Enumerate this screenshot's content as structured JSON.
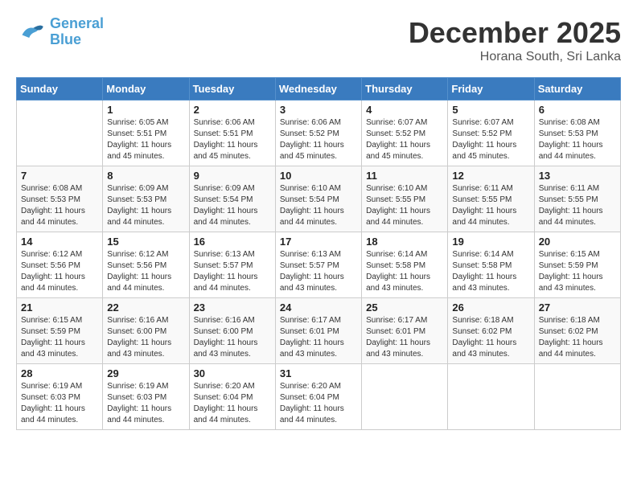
{
  "header": {
    "logo_line1": "General",
    "logo_line2": "Blue",
    "month": "December 2025",
    "location": "Horana South, Sri Lanka"
  },
  "days_of_week": [
    "Sunday",
    "Monday",
    "Tuesday",
    "Wednesday",
    "Thursday",
    "Friday",
    "Saturday"
  ],
  "weeks": [
    [
      {
        "day": "",
        "info": ""
      },
      {
        "day": "1",
        "info": "Sunrise: 6:05 AM\nSunset: 5:51 PM\nDaylight: 11 hours and 45 minutes."
      },
      {
        "day": "2",
        "info": "Sunrise: 6:06 AM\nSunset: 5:51 PM\nDaylight: 11 hours and 45 minutes."
      },
      {
        "day": "3",
        "info": "Sunrise: 6:06 AM\nSunset: 5:52 PM\nDaylight: 11 hours and 45 minutes."
      },
      {
        "day": "4",
        "info": "Sunrise: 6:07 AM\nSunset: 5:52 PM\nDaylight: 11 hours and 45 minutes."
      },
      {
        "day": "5",
        "info": "Sunrise: 6:07 AM\nSunset: 5:52 PM\nDaylight: 11 hours and 45 minutes."
      },
      {
        "day": "6",
        "info": "Sunrise: 6:08 AM\nSunset: 5:53 PM\nDaylight: 11 hours and 44 minutes."
      }
    ],
    [
      {
        "day": "7",
        "info": "Sunrise: 6:08 AM\nSunset: 5:53 PM\nDaylight: 11 hours and 44 minutes."
      },
      {
        "day": "8",
        "info": "Sunrise: 6:09 AM\nSunset: 5:53 PM\nDaylight: 11 hours and 44 minutes."
      },
      {
        "day": "9",
        "info": "Sunrise: 6:09 AM\nSunset: 5:54 PM\nDaylight: 11 hours and 44 minutes."
      },
      {
        "day": "10",
        "info": "Sunrise: 6:10 AM\nSunset: 5:54 PM\nDaylight: 11 hours and 44 minutes."
      },
      {
        "day": "11",
        "info": "Sunrise: 6:10 AM\nSunset: 5:55 PM\nDaylight: 11 hours and 44 minutes."
      },
      {
        "day": "12",
        "info": "Sunrise: 6:11 AM\nSunset: 5:55 PM\nDaylight: 11 hours and 44 minutes."
      },
      {
        "day": "13",
        "info": "Sunrise: 6:11 AM\nSunset: 5:55 PM\nDaylight: 11 hours and 44 minutes."
      }
    ],
    [
      {
        "day": "14",
        "info": "Sunrise: 6:12 AM\nSunset: 5:56 PM\nDaylight: 11 hours and 44 minutes."
      },
      {
        "day": "15",
        "info": "Sunrise: 6:12 AM\nSunset: 5:56 PM\nDaylight: 11 hours and 44 minutes."
      },
      {
        "day": "16",
        "info": "Sunrise: 6:13 AM\nSunset: 5:57 PM\nDaylight: 11 hours and 44 minutes."
      },
      {
        "day": "17",
        "info": "Sunrise: 6:13 AM\nSunset: 5:57 PM\nDaylight: 11 hours and 43 minutes."
      },
      {
        "day": "18",
        "info": "Sunrise: 6:14 AM\nSunset: 5:58 PM\nDaylight: 11 hours and 43 minutes."
      },
      {
        "day": "19",
        "info": "Sunrise: 6:14 AM\nSunset: 5:58 PM\nDaylight: 11 hours and 43 minutes."
      },
      {
        "day": "20",
        "info": "Sunrise: 6:15 AM\nSunset: 5:59 PM\nDaylight: 11 hours and 43 minutes."
      }
    ],
    [
      {
        "day": "21",
        "info": "Sunrise: 6:15 AM\nSunset: 5:59 PM\nDaylight: 11 hours and 43 minutes."
      },
      {
        "day": "22",
        "info": "Sunrise: 6:16 AM\nSunset: 6:00 PM\nDaylight: 11 hours and 43 minutes."
      },
      {
        "day": "23",
        "info": "Sunrise: 6:16 AM\nSunset: 6:00 PM\nDaylight: 11 hours and 43 minutes."
      },
      {
        "day": "24",
        "info": "Sunrise: 6:17 AM\nSunset: 6:01 PM\nDaylight: 11 hours and 43 minutes."
      },
      {
        "day": "25",
        "info": "Sunrise: 6:17 AM\nSunset: 6:01 PM\nDaylight: 11 hours and 43 minutes."
      },
      {
        "day": "26",
        "info": "Sunrise: 6:18 AM\nSunset: 6:02 PM\nDaylight: 11 hours and 43 minutes."
      },
      {
        "day": "27",
        "info": "Sunrise: 6:18 AM\nSunset: 6:02 PM\nDaylight: 11 hours and 44 minutes."
      }
    ],
    [
      {
        "day": "28",
        "info": "Sunrise: 6:19 AM\nSunset: 6:03 PM\nDaylight: 11 hours and 44 minutes."
      },
      {
        "day": "29",
        "info": "Sunrise: 6:19 AM\nSunset: 6:03 PM\nDaylight: 11 hours and 44 minutes."
      },
      {
        "day": "30",
        "info": "Sunrise: 6:20 AM\nSunset: 6:04 PM\nDaylight: 11 hours and 44 minutes."
      },
      {
        "day": "31",
        "info": "Sunrise: 6:20 AM\nSunset: 6:04 PM\nDaylight: 11 hours and 44 minutes."
      },
      {
        "day": "",
        "info": ""
      },
      {
        "day": "",
        "info": ""
      },
      {
        "day": "",
        "info": ""
      }
    ]
  ]
}
